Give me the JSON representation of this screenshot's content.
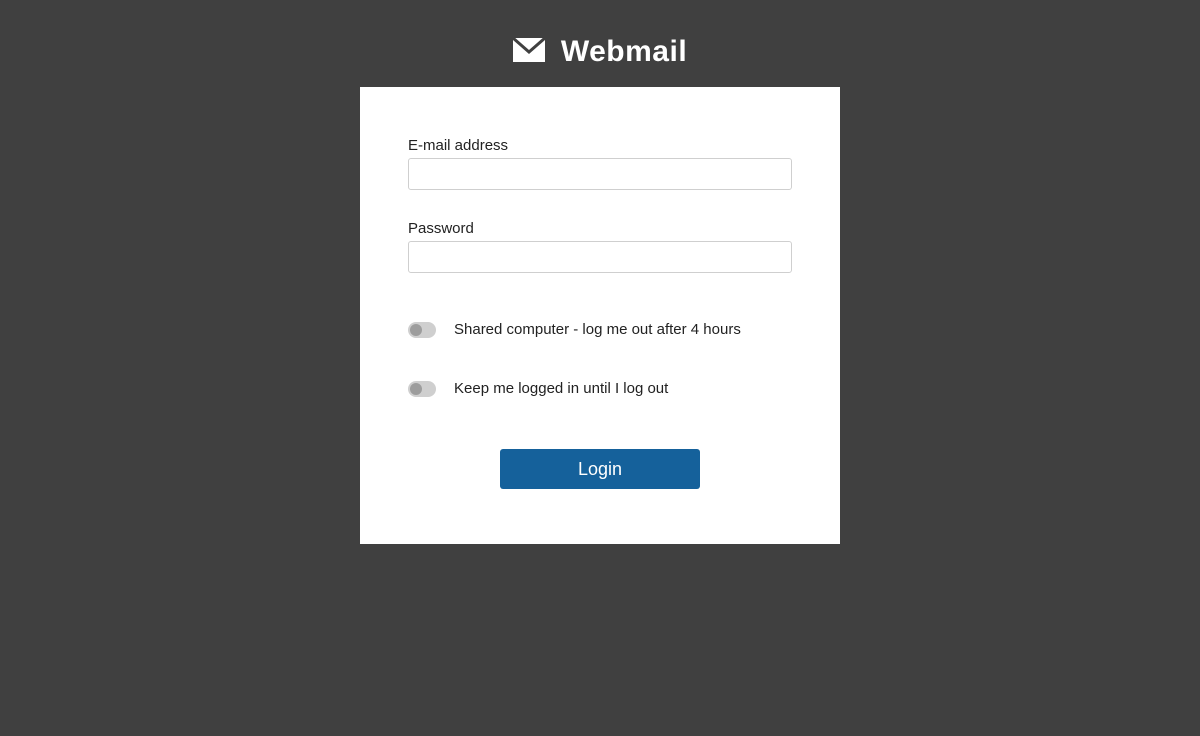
{
  "header": {
    "title": "Webmail"
  },
  "form": {
    "email_label": "E-mail address",
    "email_value": "",
    "password_label": "Password",
    "password_value": "",
    "toggle_shared_label": "Shared computer - log me out after 4 hours",
    "toggle_shared_on": false,
    "toggle_keep_label": "Keep me logged in until I log out",
    "toggle_keep_on": false,
    "login_button_label": "Login"
  }
}
